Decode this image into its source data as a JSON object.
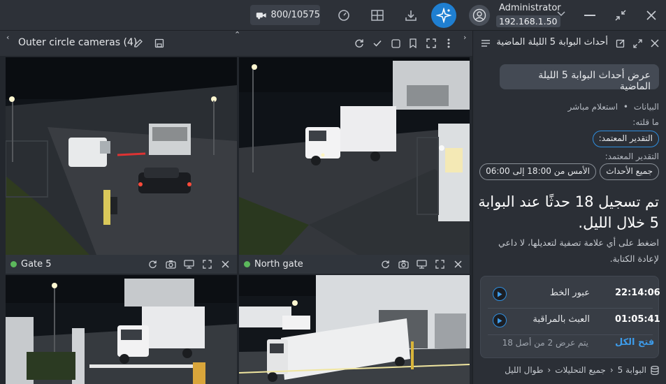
{
  "topbar": {
    "license_usage": "800/10575",
    "user_name": "Administrator",
    "user_ip": "192.168.1.50"
  },
  "layout": {
    "title": "Outer circle cameras (4)"
  },
  "cameras": [
    {
      "name": "Gate 5",
      "status": "online",
      "status_color": "#5cb85c"
    },
    {
      "name": "North gate",
      "status": "online",
      "status_color": "#5cb85c"
    },
    {
      "name": "",
      "status": ""
    },
    {
      "name": "",
      "status": ""
    }
  ],
  "panel": {
    "title": "أحداث البوابة 5 الليلة الماضية",
    "user_query": "عرض أحداث البوابة 5 الليلة الماضية",
    "meta_source": "البيانات",
    "meta_mode": "استعلام مباشر",
    "you_said_label": "ما قلته:",
    "you_said_chip": "التقدير المعتمد:",
    "estimate_label": "التقدير المعتمد:",
    "chip_events": "جميع الأحداث",
    "chip_range": "الأمس من 18:00 إلى 06:00",
    "headline": "تم تسجيل 18 حدثًا عند البوابة 5 خلال الليل.",
    "hint": "اضغط على أي علامة تصفية لتعديلها، لا داعي لإعادة الكتابة.",
    "events": [
      {
        "time": "22:14:06",
        "label": "عبور الخط"
      },
      {
        "time": "01:05:41",
        "label": "العبث بالمراقبة"
      }
    ],
    "open_all": "فتح الكل",
    "shown_count": "يتم عرض 2 من أصل 18",
    "breadcrumb": [
      "البوابة 5",
      "جميع التحليلات",
      "طوال الليل"
    ]
  },
  "colors": {
    "accent": "#1f7fd1",
    "link": "#3d9be9",
    "online": "#5cb85c"
  }
}
